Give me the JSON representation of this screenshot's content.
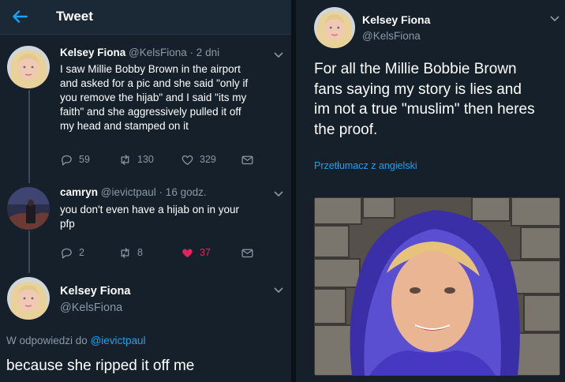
{
  "left_panel": {
    "header": {
      "title": "Tweet",
      "back_icon": "arrow-left-icon"
    },
    "tweet1": {
      "name": "Kelsey Fiona",
      "handle": "@KelsFiona",
      "time": "· 2 dni",
      "lines": [
        "I saw Millie Bobby Brown in the airport",
        "and asked for a pic and she said \"only if",
        "you remove the hijab\" and I said \"its my",
        "faith\" and she aggressively pulled it off",
        "my head and stamped on it"
      ],
      "replies": "59",
      "retweets": "130",
      "likes": "329"
    },
    "reply1": {
      "name": "camryn",
      "handle": "@ievictpaul",
      "time": "· 16 godz.",
      "lines": [
        "you don't even have a hijab on in your",
        "pfp"
      ],
      "replies": "2",
      "retweets": "8",
      "likes": "37",
      "liked_color": "#e0245e"
    },
    "reply2": {
      "name": "Kelsey Fiona",
      "handle": "@KelsFiona",
      "in_reply_prefix": "W odpowiedzi do",
      "in_reply_handle": "@ievictpaul",
      "text": "because she ripped it off me"
    }
  },
  "right_panel": {
    "name": "Kelsey Fiona",
    "handle": "@KelsFiona",
    "lines": [
      "For all the Millie Bobbie Brown",
      "fans saying my story is lies and",
      "im not a true \"muslim\" then heres",
      "the proof."
    ],
    "translate": "Przetłumacz z angielski",
    "photo_icon": "hijab-photo"
  },
  "colors": {
    "background": "#15202b",
    "secondary_text": "#8899a6",
    "link": "#1da1f2",
    "like": "#e0245e"
  }
}
